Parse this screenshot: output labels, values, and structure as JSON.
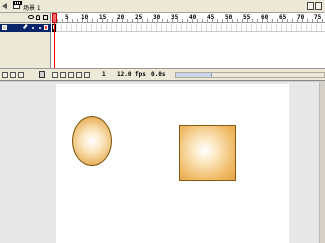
{
  "scene_bar": {
    "scene_label": "场景 1"
  },
  "timeline": {
    "layer_name": "",
    "ruler_labels": [
      "1",
      "5",
      "10",
      "15",
      "20",
      "25",
      "30",
      "35",
      "40",
      "45",
      "50",
      "55",
      "60",
      "65",
      "70",
      "75"
    ],
    "status": {
      "current_frame": "1",
      "frame_rate": "12.0 fps",
      "elapsed_time": "0.0s"
    }
  },
  "stage": {
    "shapes": [
      {
        "kind": "circle",
        "fill": "#e5a84b"
      },
      {
        "kind": "square",
        "fill": "#f0bb68"
      }
    ]
  },
  "colors": {
    "selected_layer": "#0a246a",
    "playhead": "#ff0000"
  }
}
